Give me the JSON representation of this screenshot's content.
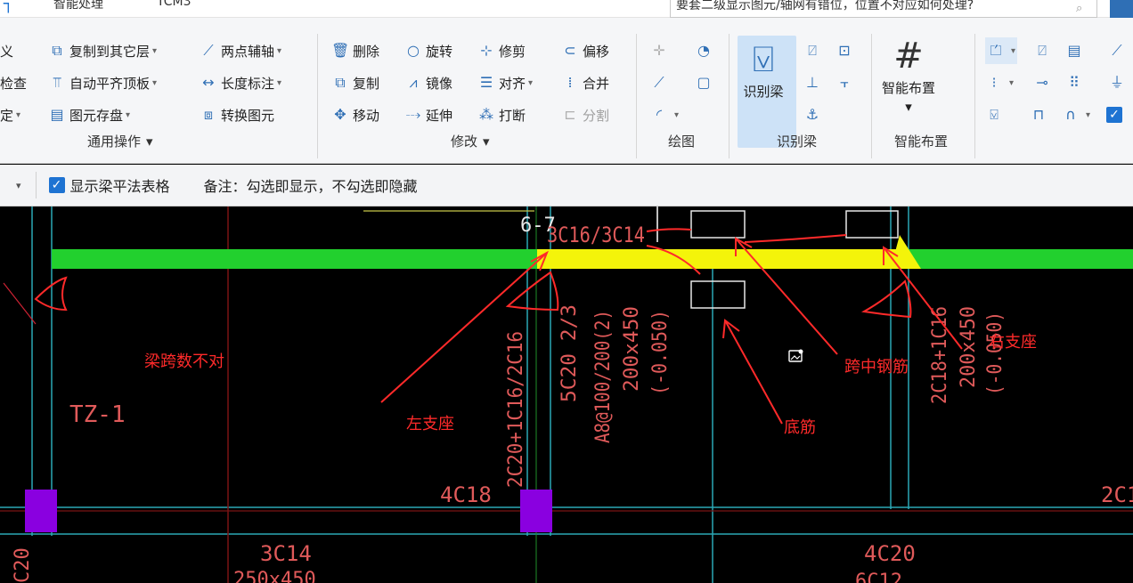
{
  "topbar": {
    "frag_left": "┐",
    "frag_mid1": "智能处理",
    "frag_mid2": "TCM3",
    "search_text": "要套二级显示图元/轴网有错位，位置不对应如何处理?"
  },
  "ribbon": {
    "col1": [
      "义",
      "检查",
      "定"
    ],
    "general": {
      "copy_to_layer": "复制到其它层",
      "auto_flat_top": "自动平齐顶板",
      "element_store": "图元存盘",
      "two_point_axis": "两点辅轴",
      "length_mark": "长度标注",
      "convert_element": "转换图元",
      "group_label": "通用操作"
    },
    "modify": {
      "delete": "删除",
      "rotate": "旋转",
      "trim": "修剪",
      "offset": "偏移",
      "copy": "复制",
      "mirror": "镜像",
      "align": "对齐",
      "merge": "合并",
      "move": "移动",
      "extend": "延伸",
      "break": "打断",
      "split": "分割",
      "group_label": "修改"
    },
    "draw": {
      "group_label": "绘图"
    },
    "identify": {
      "big_label": "识别梁",
      "group_label": "识别梁"
    },
    "smart": {
      "big_label": "智能布置",
      "group_label": "智能布置"
    }
  },
  "optbar": {
    "show_table_label": "显示梁平法表格",
    "note": "备注：勾选即显示，不勾选即隐藏"
  },
  "drawing": {
    "labels": {
      "span_top": "6-7",
      "top_rebar": "3C16/3C14",
      "left_vert": "2C20+1C16/2C16",
      "mid_vert1": "5C20 2/3",
      "mid_vert2": "A8@100/200(2)",
      "mid_vert3": "200x450",
      "mid_vert4": "(-0.050)",
      "right_vert1": "2C18+1C16",
      "right_vert2": "200x450",
      "right_vert3": "(-0.050)",
      "tz": "TZ-1",
      "bottom_4c18": "4C18",
      "bottom_3c14": "3C14",
      "bottom_250": "250x450",
      "bottom_4c20": "4C20",
      "bottom_4c12": "6C12",
      "left_c20": "C20",
      "right_2c1": "2C1"
    },
    "annotations": {
      "wrong_span": "梁跨数不对",
      "left_support": "左支座",
      "bottom_rebar": "底筋",
      "mid_rebar": "跨中钢筋",
      "right_support": "右支座"
    }
  }
}
